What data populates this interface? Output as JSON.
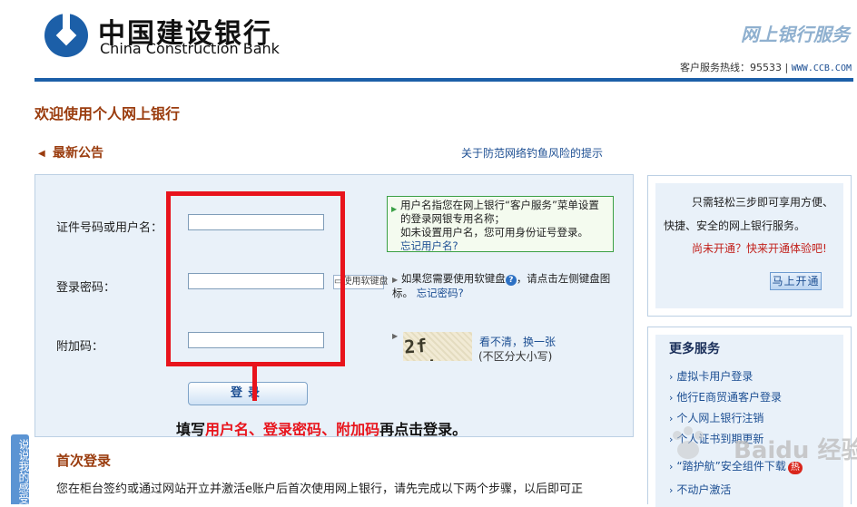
{
  "header": {
    "bank_name_cn": "中国建设银行",
    "bank_name_en": "China Construction Bank",
    "service_title": "网上银行服务",
    "hotline_label": "客户服务热线：",
    "hotline_number": "95533",
    "separator": "|",
    "site_link": "WWW.CCB.COM",
    "accent_color": "#1c5fa8"
  },
  "welcome": "欢迎使用个人网上银行",
  "notice": {
    "title": "最新公告",
    "link": "关于防范网络钓鱼风险的提示"
  },
  "login": {
    "username_label": "证件号码或用户名：",
    "password_label": "登录密码：",
    "captcha_label": "附加码：",
    "username_value": "",
    "password_value": "",
    "captcha_value": "",
    "hint_line1": "用户名指您在网上银行“客户服务”菜单设置的登录网银专用名称；",
    "hint_line2": "如未设置用户名，您可用身份证号登录。",
    "forgot_username": "忘记用户名?",
    "soft_keyboard": "使用软键盘",
    "pwd_tip": "如果您需要使用软键盘",
    "pwd_tip_rest": "，请点击左侧键盘图标。",
    "forgot_password": "忘记密码?",
    "captcha_text": "2f yxh",
    "refresh_captcha": "看不清，换一张",
    "case_insensitive": "(不区分大小写)",
    "login_button": "登录"
  },
  "annotation": {
    "prefix": "填写",
    "username": "用户名",
    "sep1": "、",
    "password": "登录密码",
    "sep2": "、",
    "captcha": "附加码",
    "suffix": "再点击登录。"
  },
  "first_login": {
    "title": "首次登录",
    "text": "您在柜台签约或通过网站开立并激活e账户后首次使用网上银行，请先完成以下两个步骤，以后即可正"
  },
  "promo": {
    "line1": "只需轻松三步即可享用方便、",
    "line2": "快捷、安全的网上银行服务。",
    "line3": "尚未开通？快来开通体验吧!",
    "open_button": "马上开通"
  },
  "more_services": {
    "title": "更多服务",
    "items": [
      "虚拟卡用户登录",
      "他行E商贸通客户登录",
      "个人网上银行注销",
      "个人证书到期更新",
      "“踏护航”安全组件下载",
      "不动户激活"
    ],
    "hot_badge": "热"
  },
  "side_tab": "说说我的感受",
  "watermark": "Baidu 经验"
}
